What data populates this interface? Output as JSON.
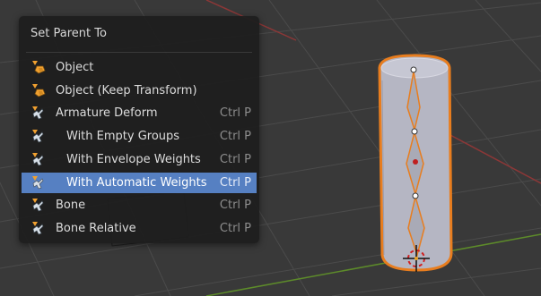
{
  "menu": {
    "title": "Set Parent To",
    "items": [
      {
        "label": "Object",
        "shortcut": "",
        "icon": "object-icon",
        "indent": false,
        "highlight": false
      },
      {
        "label": "Object (Keep Transform)",
        "shortcut": "",
        "icon": "object-icon",
        "indent": false,
        "highlight": false
      },
      {
        "label": "Armature Deform",
        "shortcut": "Ctrl P",
        "icon": "armature-icon",
        "indent": false,
        "highlight": false
      },
      {
        "label": "With Empty Groups",
        "shortcut": "Ctrl P",
        "icon": "armature-icon",
        "indent": true,
        "highlight": false
      },
      {
        "label": "With Envelope Weights",
        "shortcut": "Ctrl P",
        "icon": "armature-icon",
        "indent": true,
        "highlight": false
      },
      {
        "label": "With Automatic Weights",
        "shortcut": "Ctrl P",
        "icon": "armature-icon",
        "indent": true,
        "highlight": true
      },
      {
        "label": "Bone",
        "shortcut": "Ctrl P",
        "icon": "armature-icon",
        "indent": false,
        "highlight": false
      },
      {
        "label": "Bone Relative",
        "shortcut": "Ctrl P",
        "icon": "armature-icon",
        "indent": false,
        "highlight": false
      }
    ]
  },
  "colors": {
    "viewport_bg": "#393939",
    "grid_line": "#4a4a4a",
    "x_axis": "#9a3a3a",
    "y_axis": "#5a8a2a",
    "mesh_fill": "#b8b8c8",
    "selection_outline": "#e87d1e",
    "menu_highlight": "#5680c2"
  }
}
